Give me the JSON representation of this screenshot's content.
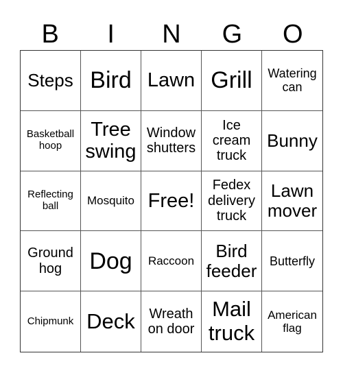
{
  "header": [
    "B",
    "I",
    "N",
    "G",
    "O"
  ],
  "cells": [
    "Steps",
    "Bird",
    "Lawn",
    "Grill",
    "Watering can",
    "Basketball hoop",
    "Tree swing",
    "Window shutters",
    "Ice cream truck",
    "Bunny",
    "Reflecting ball",
    "Mosquito",
    "Free!",
    "Fedex delivery truck",
    "Lawn mover",
    "Ground hog",
    "Dog",
    "Raccoon",
    "Bird feeder",
    "Butterfly",
    "Chipmunk",
    "Deck",
    "Wreath on door",
    "Mail truck",
    "American flag"
  ]
}
